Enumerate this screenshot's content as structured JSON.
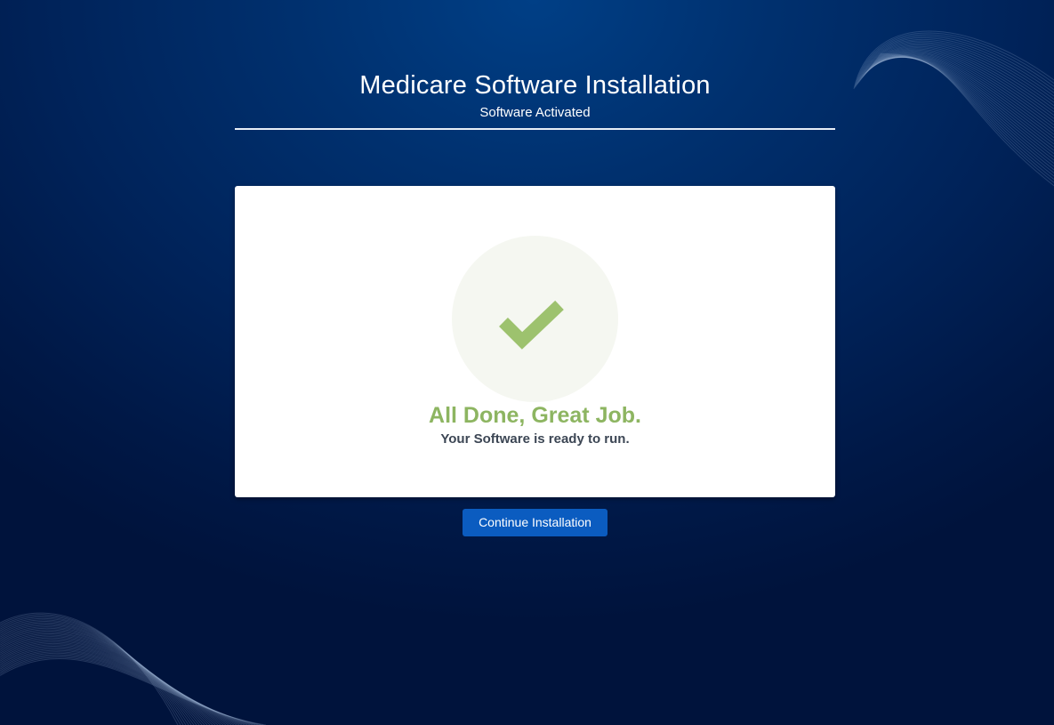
{
  "header": {
    "title": "Medicare Software Installation",
    "subtitle": "Software Activated"
  },
  "status_card": {
    "icon": "checkmark-icon",
    "heading": "All Done, Great Job.",
    "message": "Your Software is ready to run."
  },
  "actions": {
    "continue_label": "Continue Installation"
  },
  "colors": {
    "background": "#00235a",
    "success_green": "#8db561",
    "button_blue": "#0b5cc0",
    "text_dark": "#3c4654"
  }
}
